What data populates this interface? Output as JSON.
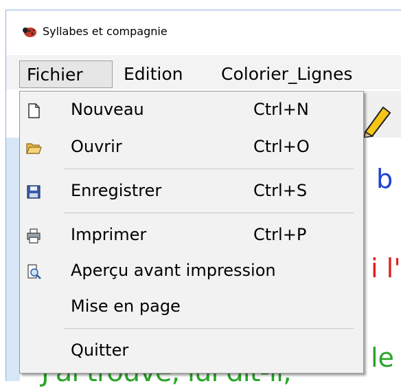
{
  "window": {
    "title": "Syllabes et compagnie"
  },
  "menubar": {
    "items": [
      "Fichier",
      "Edition",
      "Colorier_Lignes"
    ]
  },
  "fichier_menu": {
    "items": [
      {
        "label": "Nouveau",
        "shortcut": "Ctrl+N",
        "icon": "new-file-icon"
      },
      {
        "label": "Ouvrir",
        "shortcut": "Ctrl+O",
        "icon": "open-folder-icon"
      },
      {
        "label": "Enregistrer",
        "shortcut": "Ctrl+S",
        "icon": "floppy-save-icon"
      },
      {
        "label": "Imprimer",
        "shortcut": "Ctrl+P",
        "icon": "printer-icon"
      },
      {
        "label": "Aperçu avant impression",
        "shortcut": "",
        "icon": "print-preview-icon"
      },
      {
        "label": "Mise en page",
        "shortcut": "",
        "icon": ""
      },
      {
        "label": "Quitter",
        "shortcut": "",
        "icon": ""
      }
    ]
  },
  "document": {
    "fragments": [
      "b",
      "i l'",
      "le"
    ],
    "bottom_line": "J'ai trouvé, lui dit-il,",
    "colors": {
      "blue": "#1f3fd6",
      "red": "#e02020",
      "green": "#2aa52a"
    }
  }
}
